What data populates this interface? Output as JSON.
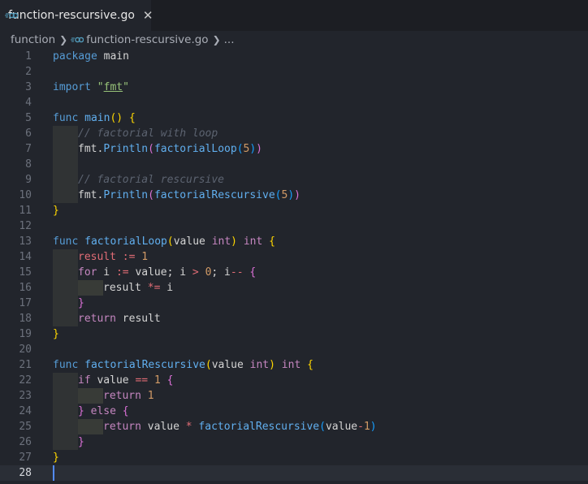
{
  "tab": {
    "label": "function-rescursive.go",
    "close": "✕"
  },
  "breadcrumb": {
    "folder": "function",
    "file": "function-rescursive.go",
    "more": "..."
  },
  "lines": [
    {
      "n": "1",
      "tokens": [
        [
          "kb",
          "package"
        ],
        [
          "plain",
          " main"
        ]
      ]
    },
    {
      "n": "2",
      "tokens": []
    },
    {
      "n": "3",
      "tokens": [
        [
          "kb",
          "import"
        ],
        [
          "plain",
          " "
        ],
        [
          "str",
          "\""
        ],
        [
          "str-u",
          "fmt"
        ],
        [
          "str",
          "\""
        ]
      ]
    },
    {
      "n": "4",
      "tokens": []
    },
    {
      "n": "5",
      "tokens": [
        [
          "kb",
          "func"
        ],
        [
          "plain",
          " "
        ],
        [
          "fn",
          "main"
        ],
        [
          "br",
          "()"
        ],
        [
          "plain",
          " "
        ],
        [
          "br",
          "{"
        ]
      ],
      "guides": 0
    },
    {
      "n": "6",
      "tokens": [
        [
          "cm",
          "// factorial with loop"
        ]
      ],
      "guides": 1
    },
    {
      "n": "7",
      "tokens": [
        [
          "plain",
          "fmt."
        ],
        [
          "fn",
          "Println"
        ],
        [
          "br2",
          "("
        ],
        [
          "fn",
          "factorialLoop"
        ],
        [
          "br3",
          "("
        ],
        [
          "num",
          "5"
        ],
        [
          "br3",
          ")"
        ],
        [
          "br2",
          ")"
        ]
      ],
      "guides": 1
    },
    {
      "n": "8",
      "tokens": [],
      "guides": 1
    },
    {
      "n": "9",
      "tokens": [
        [
          "cm",
          "// factorial rescursive"
        ]
      ],
      "guides": 1
    },
    {
      "n": "10",
      "tokens": [
        [
          "plain",
          "fmt."
        ],
        [
          "fn",
          "Println"
        ],
        [
          "br2",
          "("
        ],
        [
          "fn",
          "factorialRescursive"
        ],
        [
          "br3",
          "("
        ],
        [
          "num",
          "5"
        ],
        [
          "br3",
          ")"
        ],
        [
          "br2",
          ")"
        ]
      ],
      "guides": 1
    },
    {
      "n": "11",
      "tokens": [
        [
          "br",
          "}"
        ]
      ]
    },
    {
      "n": "12",
      "tokens": []
    },
    {
      "n": "13",
      "tokens": [
        [
          "kb",
          "func"
        ],
        [
          "plain",
          " "
        ],
        [
          "fn",
          "factorialLoop"
        ],
        [
          "br",
          "("
        ],
        [
          "plain",
          "value "
        ],
        [
          "ty",
          "int"
        ],
        [
          "br",
          ")"
        ],
        [
          "plain",
          " "
        ],
        [
          "ty",
          "int"
        ],
        [
          "plain",
          " "
        ],
        [
          "br",
          "{"
        ]
      ]
    },
    {
      "n": "14",
      "tokens": [
        [
          "var",
          "result"
        ],
        [
          "plain",
          " "
        ],
        [
          "op",
          ":="
        ],
        [
          "plain",
          " "
        ],
        [
          "num",
          "1"
        ]
      ],
      "guides": 1
    },
    {
      "n": "15",
      "tokens": [
        [
          "kw",
          "for"
        ],
        [
          "plain",
          " i "
        ],
        [
          "op",
          ":="
        ],
        [
          "plain",
          " value; i "
        ],
        [
          "op",
          ">"
        ],
        [
          "plain",
          " "
        ],
        [
          "num",
          "0"
        ],
        [
          "plain",
          "; i"
        ],
        [
          "op",
          "--"
        ],
        [
          "plain",
          " "
        ],
        [
          "br2",
          "{"
        ]
      ],
      "guides": 1
    },
    {
      "n": "16",
      "tokens": [
        [
          "plain",
          "result "
        ],
        [
          "op",
          "*="
        ],
        [
          "plain",
          " i"
        ]
      ],
      "guides": 2
    },
    {
      "n": "17",
      "tokens": [
        [
          "br2",
          "}"
        ]
      ],
      "guides": 1
    },
    {
      "n": "18",
      "tokens": [
        [
          "kw",
          "return"
        ],
        [
          "plain",
          " result"
        ]
      ],
      "guides": 1
    },
    {
      "n": "19",
      "tokens": [
        [
          "br",
          "}"
        ]
      ]
    },
    {
      "n": "20",
      "tokens": []
    },
    {
      "n": "21",
      "tokens": [
        [
          "kb",
          "func"
        ],
        [
          "plain",
          " "
        ],
        [
          "fn",
          "factorialRescursive"
        ],
        [
          "br",
          "("
        ],
        [
          "plain",
          "value "
        ],
        [
          "ty",
          "int"
        ],
        [
          "br",
          ")"
        ],
        [
          "plain",
          " "
        ],
        [
          "ty",
          "int"
        ],
        [
          "plain",
          " "
        ],
        [
          "br",
          "{"
        ]
      ]
    },
    {
      "n": "22",
      "tokens": [
        [
          "kw",
          "if"
        ],
        [
          "plain",
          " value "
        ],
        [
          "op",
          "=="
        ],
        [
          "plain",
          " "
        ],
        [
          "num",
          "1"
        ],
        [
          "plain",
          " "
        ],
        [
          "br2",
          "{"
        ]
      ],
      "guides": 1
    },
    {
      "n": "23",
      "tokens": [
        [
          "kw",
          "return"
        ],
        [
          "plain",
          " "
        ],
        [
          "num",
          "1"
        ]
      ],
      "guides": 2
    },
    {
      "n": "24",
      "tokens": [
        [
          "br2",
          "}"
        ],
        [
          "plain",
          " "
        ],
        [
          "kw",
          "else"
        ],
        [
          "plain",
          " "
        ],
        [
          "br2",
          "{"
        ]
      ],
      "guides": 1
    },
    {
      "n": "25",
      "tokens": [
        [
          "kw",
          "return"
        ],
        [
          "plain",
          " value "
        ],
        [
          "op",
          "*"
        ],
        [
          "plain",
          " "
        ],
        [
          "fn",
          "factorialRescursive"
        ],
        [
          "br3",
          "("
        ],
        [
          "plain",
          "value"
        ],
        [
          "op",
          "-"
        ],
        [
          "num",
          "1"
        ],
        [
          "br3",
          ")"
        ]
      ],
      "guides": 2
    },
    {
      "n": "26",
      "tokens": [
        [
          "br2",
          "}"
        ]
      ],
      "guides": 1
    },
    {
      "n": "27",
      "tokens": [
        [
          "br",
          "}"
        ]
      ]
    },
    {
      "n": "28",
      "tokens": [],
      "current": true
    }
  ]
}
